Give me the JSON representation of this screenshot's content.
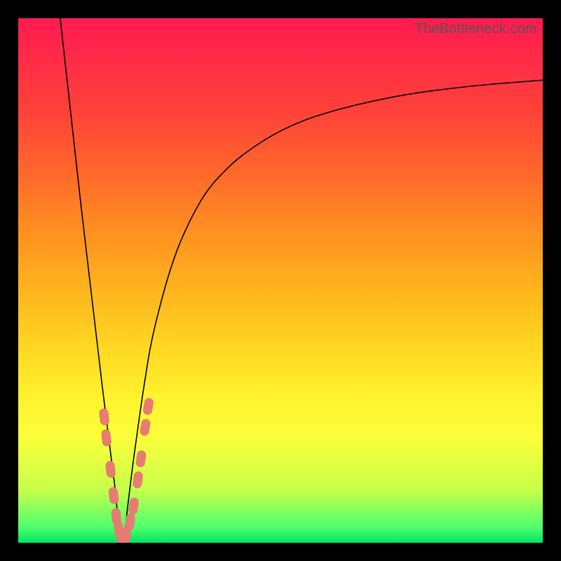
{
  "watermark": "TheBottleneck.com",
  "colors": {
    "marker": "#e87c72",
    "curve": "#000000"
  },
  "chart_data": {
    "type": "line",
    "title": "",
    "xlabel": "",
    "ylabel": "",
    "xlim": [
      0,
      100
    ],
    "ylim": [
      0,
      100
    ],
    "grid": false,
    "legend": false,
    "annotations": [],
    "series": [
      {
        "name": "curve",
        "x": [
          8,
          10,
          12,
          14,
          16,
          17,
          18,
          18.5,
          19,
          19.5,
          20,
          21,
          22,
          24,
          26,
          30,
          35,
          40,
          45,
          50,
          55,
          60,
          65,
          70,
          75,
          80,
          85,
          90,
          95,
          100
        ],
        "y": [
          100,
          82,
          64,
          47,
          30,
          22,
          14,
          10,
          5,
          2,
          0,
          8,
          16,
          30,
          41,
          55,
          65.5,
          71.5,
          75.5,
          78.5,
          80.7,
          82.3,
          83.6,
          84.7,
          85.6,
          86.3,
          86.9,
          87.4,
          87.8,
          88.2
        ]
      }
    ],
    "markers": {
      "name": "highlighted-points",
      "style": "pill",
      "points": [
        {
          "x": 16.4,
          "y": 24
        },
        {
          "x": 16.8,
          "y": 20
        },
        {
          "x": 17.6,
          "y": 14
        },
        {
          "x": 18.2,
          "y": 9
        },
        {
          "x": 18.7,
          "y": 5
        },
        {
          "x": 19.2,
          "y": 2.5
        },
        {
          "x": 19.6,
          "y": 0.8
        },
        {
          "x": 20.0,
          "y": 0.5
        },
        {
          "x": 20.6,
          "y": 1.5
        },
        {
          "x": 21.3,
          "y": 4
        },
        {
          "x": 22.0,
          "y": 7
        },
        {
          "x": 22.8,
          "y": 12
        },
        {
          "x": 23.4,
          "y": 16
        },
        {
          "x": 24.2,
          "y": 22
        },
        {
          "x": 24.8,
          "y": 26
        }
      ]
    }
  }
}
